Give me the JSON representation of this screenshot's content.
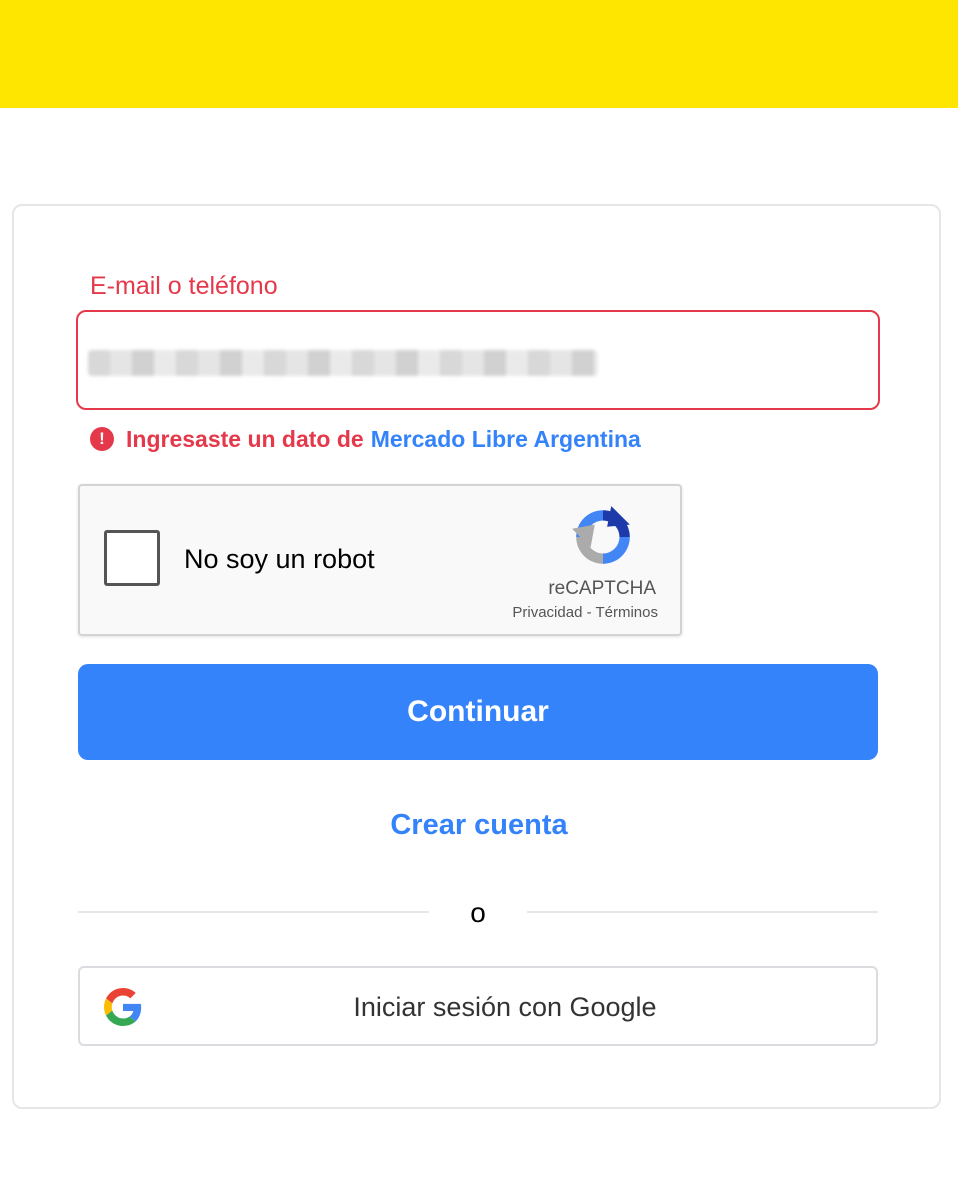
{
  "header": {
    "color": "#ffe600"
  },
  "login": {
    "field_label": "E-mail o teléfono",
    "field_value_state": "blurred",
    "error_icon": "!",
    "error_text": "Ingresaste un dato de",
    "error_link": "Mercado Libre Argentina",
    "continue_label": "Continuar",
    "create_account_label": "Crear cuenta",
    "divider_text": "o",
    "google_label": "Iniciar sesión con Google"
  },
  "recaptcha": {
    "label": "No soy un robot",
    "brand": "reCAPTCHA",
    "privacy_link": "Privacidad",
    "separator": " - ",
    "terms_link": "Términos",
    "checked": false
  },
  "icons": {
    "error": "exclamation-circle-icon",
    "recaptcha": "recaptcha-logo-icon",
    "google": "google-g-icon"
  },
  "colors": {
    "accent": "#3483fa",
    "error": "#e5394b",
    "brand_yellow": "#ffe600"
  }
}
